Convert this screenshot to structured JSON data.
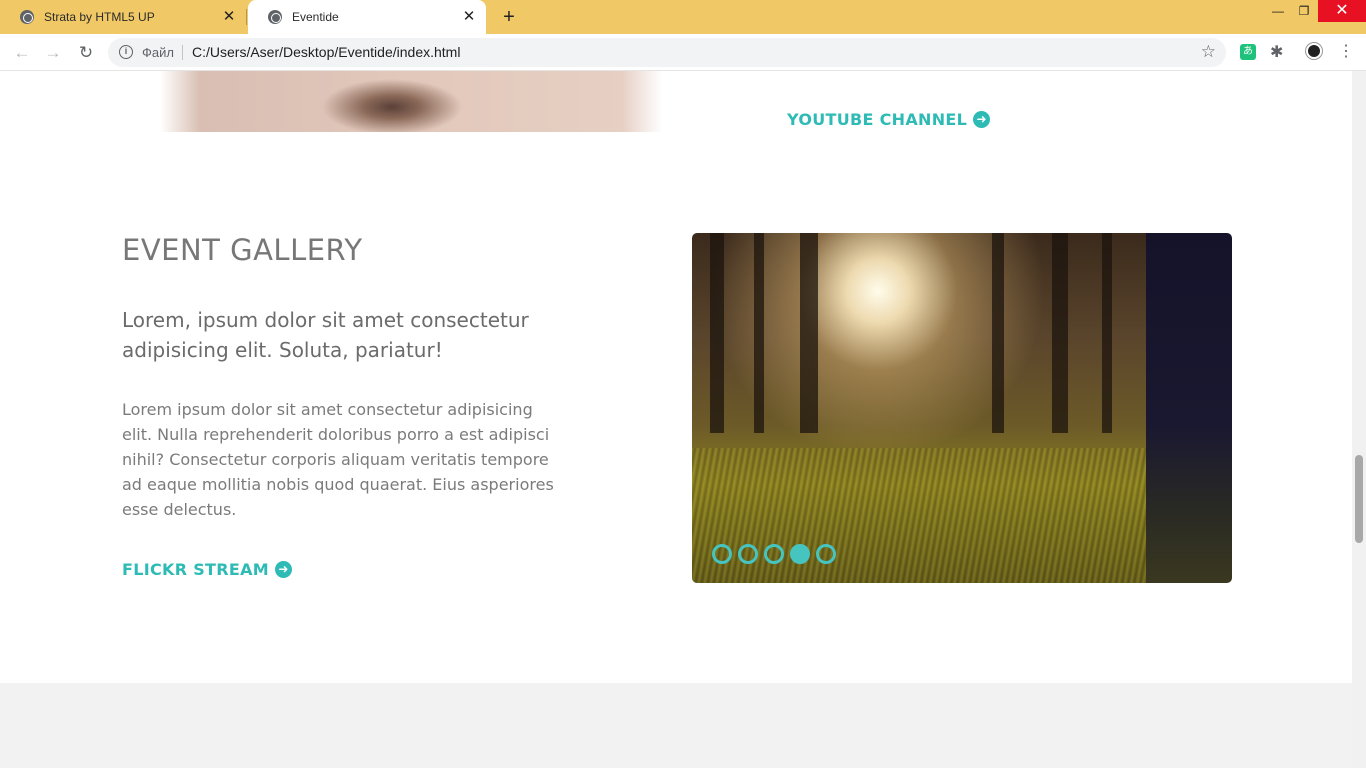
{
  "browser": {
    "tabs": [
      {
        "title": "Strata by HTML5 UP",
        "active": false
      },
      {
        "title": "Eventide",
        "active": true
      }
    ],
    "address": {
      "scheme_label": "Файл",
      "url": "C:/Users/Aser/Desktop/Eventide/index.html"
    },
    "icons": {
      "back": "arrow-left-icon",
      "forward": "arrow-right-icon",
      "reload": "reload-icon",
      "bookmark": "star-icon",
      "extensions": "puzzle-icon",
      "menu": "kebab-menu-icon"
    }
  },
  "page": {
    "youtube_link": "YOUTUBE CHANNEL",
    "gallery": {
      "title": "EVENT GALLERY",
      "lead": "Lorem, ipsum dolor sit amet consectetur adipisicing elit. Soluta, pariatur!",
      "body": "Lorem ipsum dolor sit amet consectetur adipisicing elit. Nulla reprehenderit doloribus porro a est adipisci nihil? Consectetur corporis aliquam veritatis tempore ad eaque mollitia nobis quod quaerat. Eius asperiores esse delectus.",
      "flickr_link": "FLICKR STREAM",
      "slider": {
        "slide_count": 5,
        "active_slide": 4
      }
    },
    "colors": {
      "accent": "#2ebbb5",
      "tabstrip": "#f0c866"
    }
  }
}
